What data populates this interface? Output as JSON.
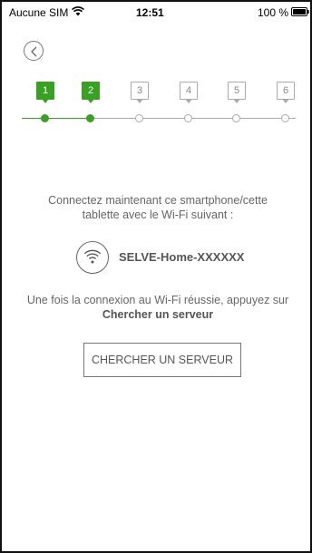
{
  "status_bar": {
    "carrier": "Aucune SIM",
    "time": "12:51",
    "battery": "100 %"
  },
  "stepper": {
    "steps": [
      {
        "label": "1",
        "state": "done"
      },
      {
        "label": "2",
        "state": "done"
      },
      {
        "label": "3",
        "state": "todo"
      },
      {
        "label": "4",
        "state": "todo"
      },
      {
        "label": "5",
        "state": "todo"
      },
      {
        "label": "6",
        "state": "todo"
      }
    ],
    "done_color": "#3aa024",
    "todo_color": "#aaaaaa"
  },
  "main": {
    "instruction_line1": "Connectez maintenant ce smartphone/cette",
    "instruction_line2": "tablette avec le Wi-Fi suivant :",
    "network_name": "SELVE-Home-XXXXXX",
    "hint_line1": "Une fois la connexion au Wi-Fi réussie, appuyez sur",
    "hint_line2": "Chercher un serveur",
    "search_button_label": "CHERCHER UN SERVEUR"
  },
  "icons": {
    "status_wifi": "wifi-icon",
    "battery": "battery-icon",
    "back": "chevron-left-icon",
    "network": "wifi-icon"
  }
}
